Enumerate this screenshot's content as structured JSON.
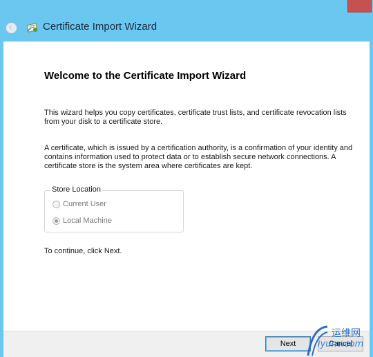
{
  "window": {
    "title": "Certificate Import Wizard"
  },
  "wizard": {
    "heading": "Welcome to the Certificate Import Wizard",
    "intro": "This wizard helps you copy certificates, certificate trust lists, and certificate revocation lists from your disk to a certificate store.",
    "description": "A certificate, which is issued by a certification authority, is a confirmation of your identity and contains information used to protect data or to establish secure network connections. A certificate store is the system area where certificates are kept.",
    "store_location": {
      "label": "Store Location",
      "options": [
        {
          "label": "Current User",
          "selected": false,
          "enabled": false
        },
        {
          "label": "Local Machine",
          "selected": true,
          "enabled": false
        }
      ]
    },
    "continue_text": "To continue, click Next."
  },
  "footer": {
    "next_label": "Next",
    "cancel_label": "Cancel"
  },
  "watermark": {
    "text_top": "运维网",
    "text_bottom": "iyunv.com"
  },
  "colors": {
    "window_frame": "#6ac7ef",
    "close_button": "#c75050",
    "content_bg": "#ffffff",
    "footer_bg": "#f0f0f0"
  },
  "icons": [
    "back-arrow-icon",
    "certificate-icon",
    "close-icon"
  ]
}
